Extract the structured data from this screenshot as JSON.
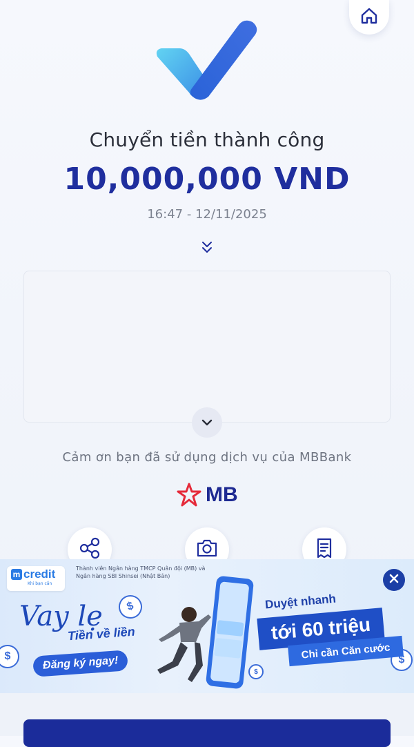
{
  "header": {
    "home_icon": "home-icon"
  },
  "result": {
    "title": "Chuyển tiền thành công",
    "amount": "10,000,000 VND",
    "datetime": "16:47 - 12/11/2025",
    "expand_icon": "double-chevron-down-icon",
    "collapse_icon": "chevron-down-icon"
  },
  "thanks_text": "Cảm ơn bạn đã sử dụng dịch vụ của MBBank",
  "brand": {
    "name": "MB",
    "color": "#e52a3a",
    "text_color": "#1e2a92"
  },
  "actions": [
    {
      "icon": "share-icon"
    },
    {
      "icon": "camera-icon"
    },
    {
      "icon": "receipt-icon"
    }
  ],
  "banner": {
    "logo_name": "credit",
    "logo_m": "m",
    "logo_tagline": "Khi bạn cần",
    "member_text": "Thành viên Ngân hàng TMCP Quân đội (MB) và Ngân hàng SBI Shinsei (Nhật Bản)",
    "headline": "Vay lẹ",
    "subheadline": "Tiền về liền",
    "cta": "Đăng ký ngay!",
    "approval": "Duyệt nhanh",
    "limit": "tới 60 triệu",
    "requirement": "Chỉ cần Căn cước",
    "coin_symbol": "$",
    "close_icon": "close-icon"
  },
  "colors": {
    "primary": "#1f2e9e",
    "accent_blue": "#2b5ed8",
    "check_gradient_start": "#5fd0f0",
    "check_gradient_end": "#2a5fd8"
  }
}
